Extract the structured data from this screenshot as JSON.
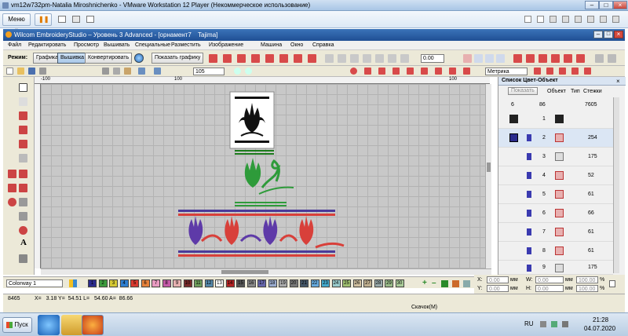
{
  "vm": {
    "title": "vm12w732pm-Natalia Miroshnichenko - VMware Workstation 12 Player (Некоммерческое использование)",
    "menu_label": "Меню"
  },
  "app": {
    "title": "Wilcom EmbroideryStudio – Уровень 3 Advanced - [орнамент7",
    "machine": "Tajima]"
  },
  "menu": [
    "Файл",
    "Редактировать",
    "Просмотр",
    "Вышивать",
    "Специальные",
    "Разместить",
    "Изображение",
    "Машина",
    "Окно",
    "Справка"
  ],
  "toolbar": {
    "mode_label": "Режим:",
    "graphics_label": "Графика",
    "embroidery_label": "Вышивка",
    "convert_label": "Конвертировать",
    "show_graphics_label": "Показать графику",
    "angle_value": "0.00",
    "zoom_value": "105",
    "units_value": "Метрика"
  },
  "ruler": {
    "t1": "-100",
    "t2": "100",
    "t3": "100"
  },
  "panel": {
    "title": "Список Цвет-Объект",
    "show_label": "Показать",
    "col_objects": "Объект",
    "col_type": "Тип",
    "col_stitches": "Стежки",
    "summary_a": "6",
    "summary_b": "86",
    "summary_total": "7605",
    "rows": [
      {
        "n": "1",
        "s": ""
      },
      {
        "n": "2",
        "s": "254"
      },
      {
        "n": "3",
        "s": "175"
      },
      {
        "n": "4",
        "s": "52"
      },
      {
        "n": "5",
        "s": "61"
      },
      {
        "n": "6",
        "s": "66"
      },
      {
        "n": "7",
        "s": "61"
      },
      {
        "n": "8",
        "s": "61"
      },
      {
        "n": "9",
        "s": "175"
      }
    ]
  },
  "colorway": {
    "label": "Colorway 1",
    "swatches": [
      {
        "n": "1",
        "c": "#2b2b8c"
      },
      {
        "n": "2",
        "c": "#3c9a3c"
      },
      {
        "n": "3",
        "c": "#d5c833"
      },
      {
        "n": "4",
        "c": "#2f7fd0"
      },
      {
        "n": "5",
        "c": "#d83a2e"
      },
      {
        "n": "6",
        "c": "#e6813a"
      },
      {
        "n": "7",
        "c": "#e89ac0"
      },
      {
        "n": "8",
        "c": "#c45aa7"
      },
      {
        "n": "9",
        "c": "#e6b0b0"
      },
      {
        "n": "10",
        "c": "#7a2a2a"
      },
      {
        "n": "11",
        "c": "#6f9f5c"
      },
      {
        "n": "12",
        "c": "#5588aa"
      },
      {
        "n": "13",
        "c": "#ffffff"
      },
      {
        "n": "14",
        "c": "#b22222"
      },
      {
        "n": "15",
        "c": "#555555"
      },
      {
        "n": "16",
        "c": "#888888"
      },
      {
        "n": "17",
        "c": "#6666aa"
      },
      {
        "n": "18",
        "c": "#99aacc"
      },
      {
        "n": "19",
        "c": "#aaaaaa"
      },
      {
        "n": "20",
        "c": "#777777"
      },
      {
        "n": "21",
        "c": "#445566"
      },
      {
        "n": "22",
        "c": "#66aadd"
      },
      {
        "n": "23",
        "c": "#44aacc"
      },
      {
        "n": "24",
        "c": "#99cccc"
      },
      {
        "n": "25",
        "c": "#a0c070"
      },
      {
        "n": "26",
        "c": "#d0c0a0"
      },
      {
        "n": "27",
        "c": "#c0b090"
      },
      {
        "n": "28",
        "c": "#9aa"
      },
      {
        "n": "29",
        "c": "#99bb88"
      },
      {
        "n": "30",
        "c": "#aacc99"
      }
    ]
  },
  "coords": {
    "x_label": "X:",
    "y_label": "Y:",
    "w_label": "W:",
    "h_label": "H:",
    "x_val": "0.00",
    "y_val": "0.00",
    "w_val": "0.00",
    "h_val": "0.00",
    "unit": "мм",
    "pct_w": "100.00",
    "pct_h": "100.00",
    "pct": "%"
  },
  "status": {
    "count": "8465",
    "position": "X=   3.18 Y=  54.51 L=   54.60 A=  86.66",
    "middle": "Скачок(М)"
  },
  "taskbar": {
    "start_label": "Пуск",
    "lang": "RU",
    "time": "21:28",
    "date": "04.07.2020"
  }
}
